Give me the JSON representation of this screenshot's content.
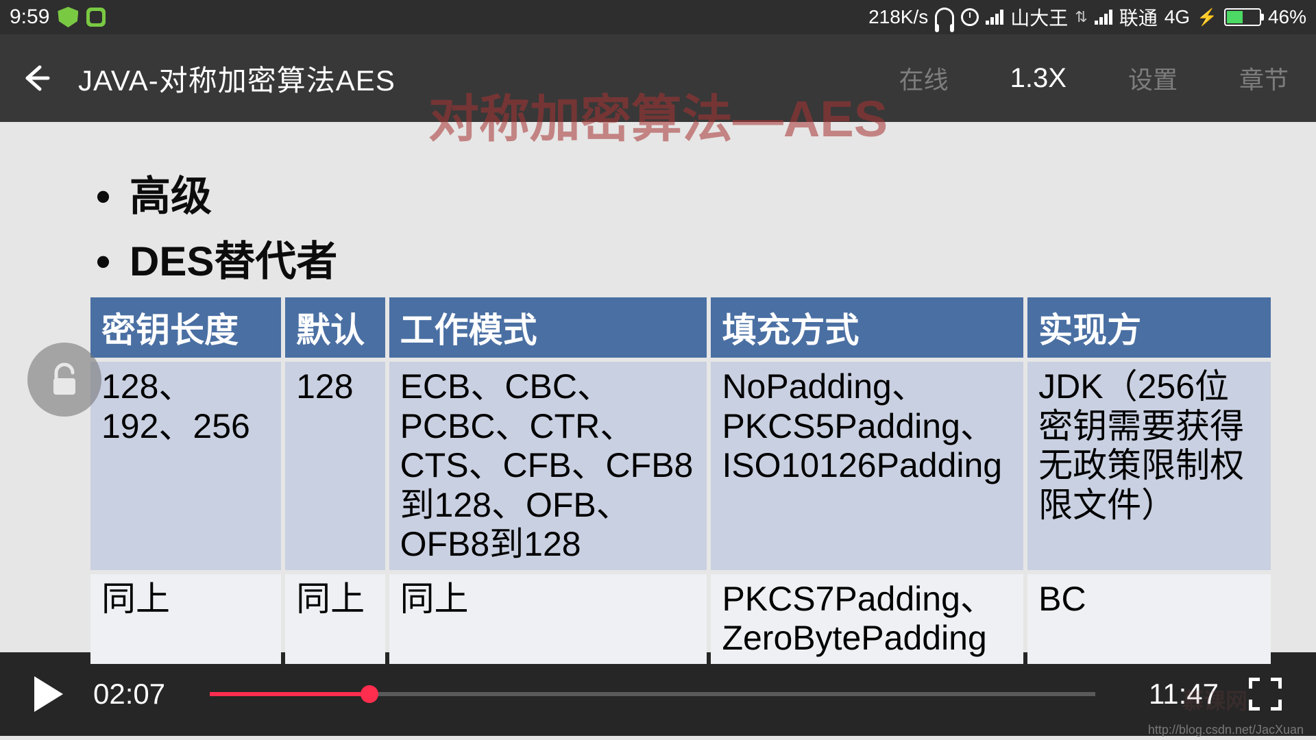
{
  "status": {
    "time": "9:59",
    "net_speed": "218K/s",
    "carrier1": "山大王",
    "carrier2": "联通",
    "net_type": "4G",
    "battery_pct": "46%"
  },
  "appbar": {
    "title": "JAVA-对称加密算法AES",
    "online": "在线",
    "speed": "1.3X",
    "settings": "设置",
    "chapter": "章节"
  },
  "slide": {
    "bg_title": "对称加密算法—AES",
    "bullet1": "高级",
    "bullet2": "DES替代者",
    "headers": {
      "c1": "密钥长度",
      "c2": "默认",
      "c3": "工作模式",
      "c4": "填充方式",
      "c5": "实现方"
    },
    "row1": {
      "c1": "128、192、256",
      "c2": "128",
      "c3": "ECB、CBC、PCBC、CTR、CTS、CFB、CFB8到128、OFB、OFB8到128",
      "c4": "NoPadding、PKCS5Padding、ISO10126Padding",
      "c5": "JDK（256位密钥需要获得无政策限制权限文件）"
    },
    "row2": {
      "c1": "同上",
      "c2": "同上",
      "c3": "同上",
      "c4": "PKCS7Padding、ZeroBytePadding",
      "c5": "BC"
    }
  },
  "player": {
    "current": "02:07",
    "total": "11:47",
    "progress_pct": 18
  },
  "watermark": {
    "url": "http://blog.csdn.net/JacXuan",
    "site": "慕课网"
  }
}
